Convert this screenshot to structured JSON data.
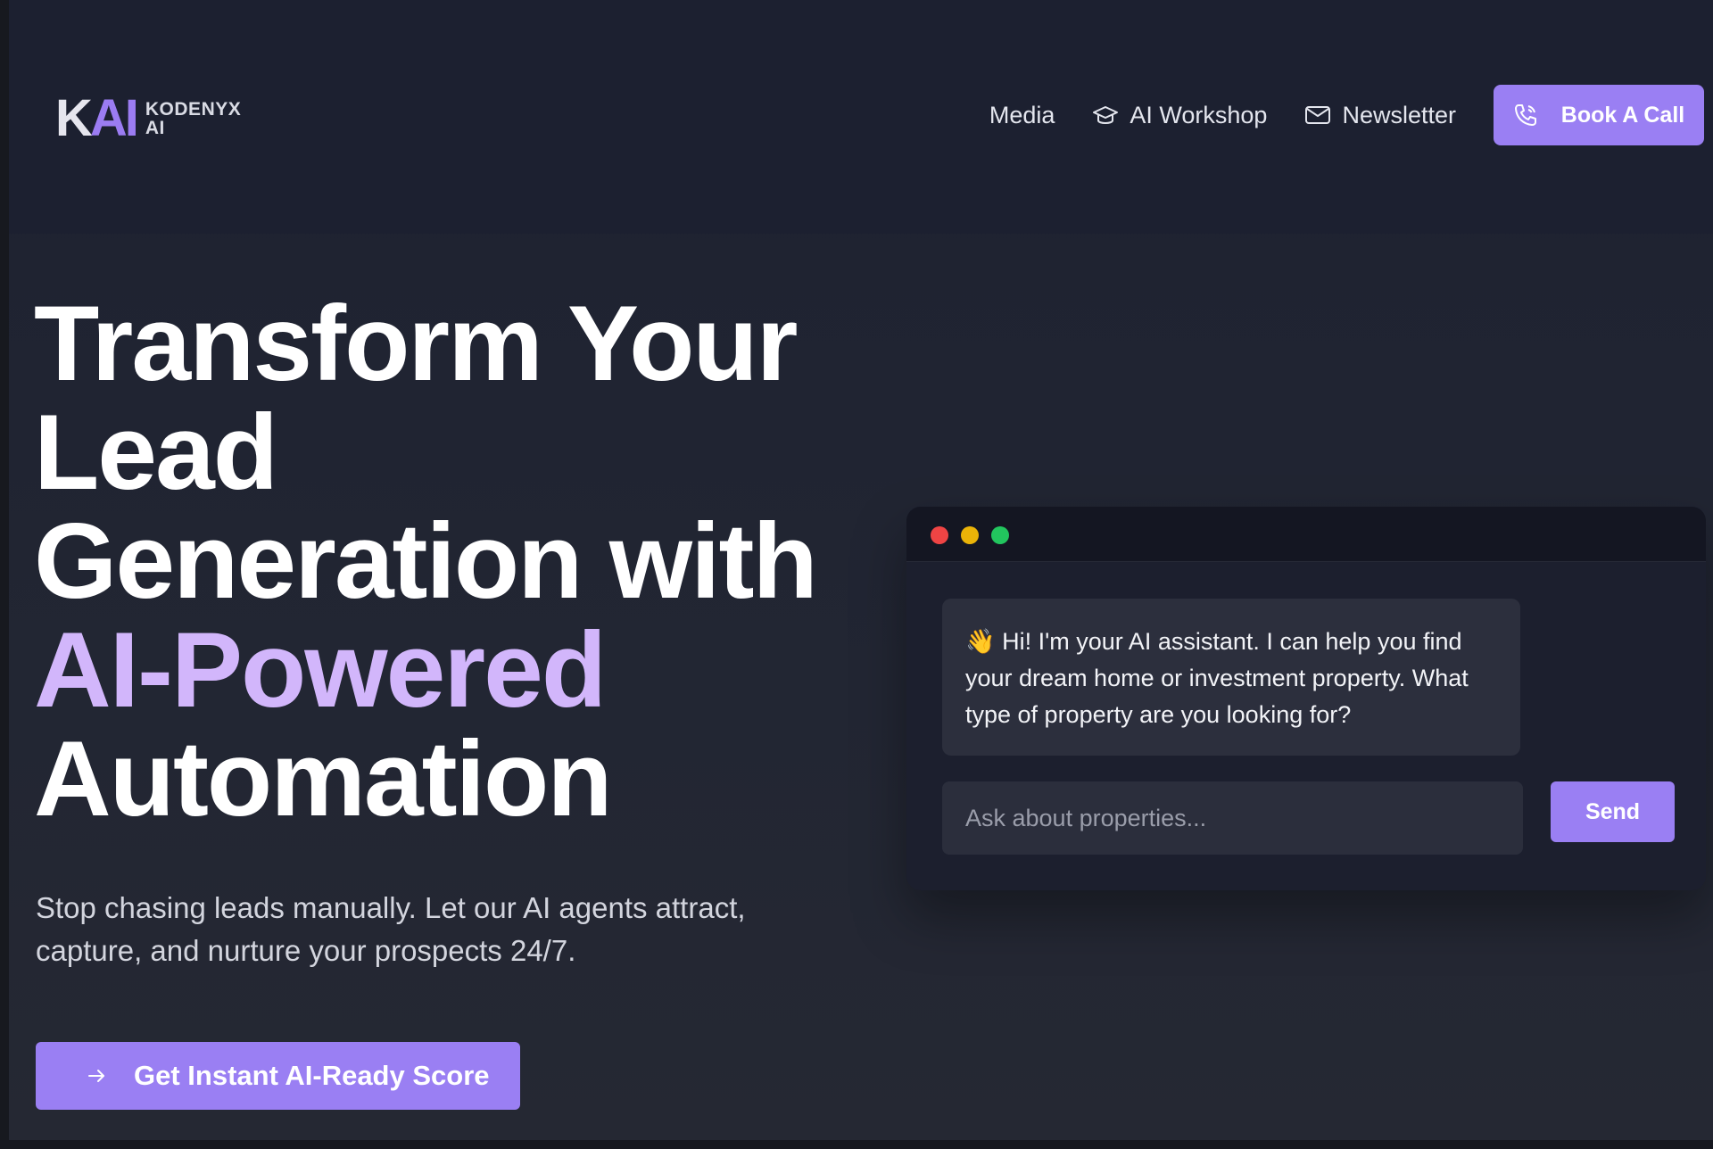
{
  "brand": {
    "mark_k": "K",
    "mark_ai": "AI",
    "name_line1": "KODENYX",
    "name_line2": "AI"
  },
  "nav": {
    "media": "Media",
    "workshop": "AI Workshop",
    "newsletter": "Newsletter",
    "book_call": "Book A Call"
  },
  "hero": {
    "title_line1": "Transform Your",
    "title_line2": "Lead",
    "title_line3": "Generation with",
    "title_accent": "AI-Powered",
    "title_line5": "Automation",
    "subtitle": "Stop chasing leads manually. Let our AI agents attract, capture, and nurture your prospects 24/7.",
    "cta": "Get Instant AI-Ready Score"
  },
  "chat": {
    "message": "👋 Hi! I'm your AI assistant. I can help you find your dream home or investment property. What type of property are you looking for?",
    "input_placeholder": "Ask about properties...",
    "input_value": "",
    "send": "Send"
  },
  "colors": {
    "accent": "#9a7ff3",
    "accent_text": "#d2b6fb",
    "background": "#1d2130",
    "dot_red": "#ef4444",
    "dot_yellow": "#eab308",
    "dot_green": "#22c55e"
  },
  "icons": [
    "graduation-cap-icon",
    "mail-icon",
    "phone-icon",
    "arrow-right-icon"
  ]
}
